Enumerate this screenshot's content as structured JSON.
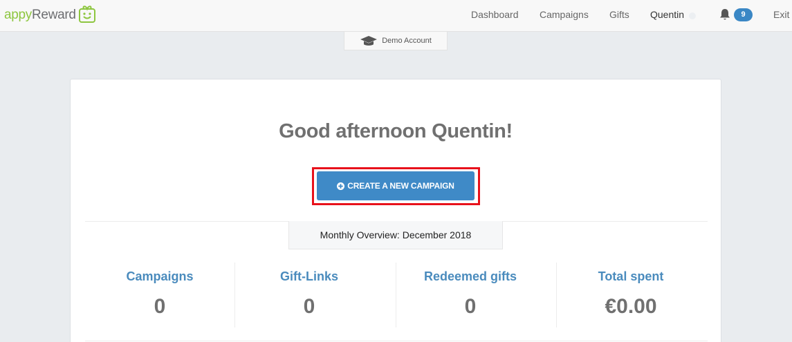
{
  "brand": {
    "logo_prefix": "appy",
    "logo_suffix": "Reward",
    "brand_color": "#8dc63f"
  },
  "nav": {
    "dashboard": "Dashboard",
    "campaigns": "Campaigns",
    "gifts": "Gifts",
    "user": "Quentin",
    "notifications_count": "9",
    "exit": "Exit"
  },
  "demo_tab": {
    "label": "Demo Account",
    "icon": "graduation-cap-icon"
  },
  "main": {
    "greeting": "Good afternoon Quentin!",
    "cta_label": "CREATE A NEW CAMPAIGN",
    "cta_icon": "plus-circle-icon",
    "overview_label": "Monthly Overview: December 2018",
    "stats": [
      {
        "label": "Campaigns",
        "value": "0"
      },
      {
        "label": "Gift-Links",
        "value": "0"
      },
      {
        "label": "Redeemed gifts",
        "value": "0"
      },
      {
        "label": "Total spent",
        "value": "€0.00"
      }
    ]
  },
  "colors": {
    "accent": "#3f8ac7",
    "highlight": "#e8111b",
    "stat_label": "#4a8bbd"
  }
}
